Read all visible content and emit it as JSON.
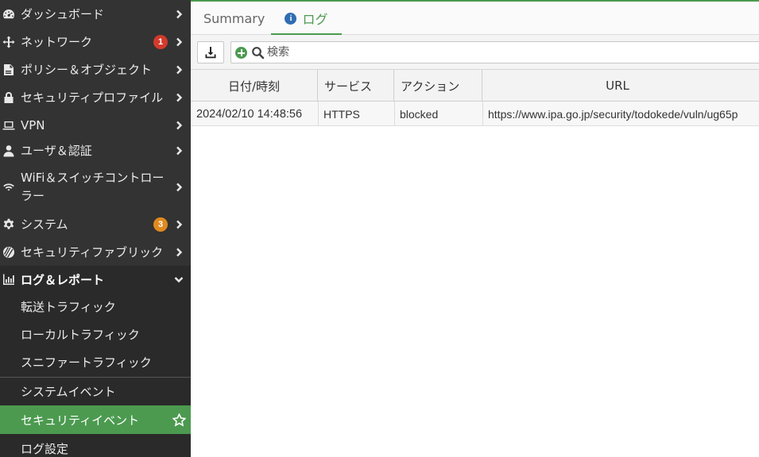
{
  "sidebar": {
    "items": [
      {
        "label": "ダッシュボード",
        "icon": "dashboard-icon"
      },
      {
        "label": "ネットワーク",
        "icon": "network-icon",
        "badge": "1",
        "badge_color": "#d33a2c"
      },
      {
        "label": "ポリシー＆オブジェクト",
        "icon": "policy-icon"
      },
      {
        "label": "セキュリティプロファイル",
        "icon": "lock-icon"
      },
      {
        "label": "VPN",
        "icon": "laptop-icon"
      },
      {
        "label": "ユーザ＆認証",
        "icon": "user-icon"
      },
      {
        "label": "WiFi＆スイッチコントローラー",
        "icon": "wifi-icon"
      },
      {
        "label": "システム",
        "icon": "gear-icon",
        "badge": "3",
        "badge_color": "#e08a1e"
      },
      {
        "label": "セキュリティファブリック",
        "icon": "fabric-icon"
      },
      {
        "label": "ログ＆レポート",
        "icon": "chart-icon",
        "expanded": true
      }
    ],
    "sub_items": [
      {
        "label": "転送トラフィック"
      },
      {
        "label": "ローカルトラフィック"
      },
      {
        "label": "スニファートラフィック"
      },
      {
        "label": "システムイベント"
      },
      {
        "label": "セキュリティイベント",
        "selected": true
      },
      {
        "label": "ログ設定"
      }
    ],
    "accent_color": "#4c9a50"
  },
  "tabs": [
    {
      "label": "Summary",
      "active": false
    },
    {
      "label": "ログ",
      "active": true,
      "icon": "info-icon"
    }
  ],
  "toolbar": {
    "download_icon": "download-icon",
    "search_placeholder": "検索"
  },
  "table": {
    "columns": [
      "日付/時刻",
      "サービス",
      "アクション",
      "URL"
    ],
    "rows": [
      {
        "datetime": "2024/02/10 14:48:56",
        "service": "HTTPS",
        "action": "blocked",
        "url": "https://www.ipa.go.jp/security/todokede/vuln/ug65p"
      }
    ]
  }
}
